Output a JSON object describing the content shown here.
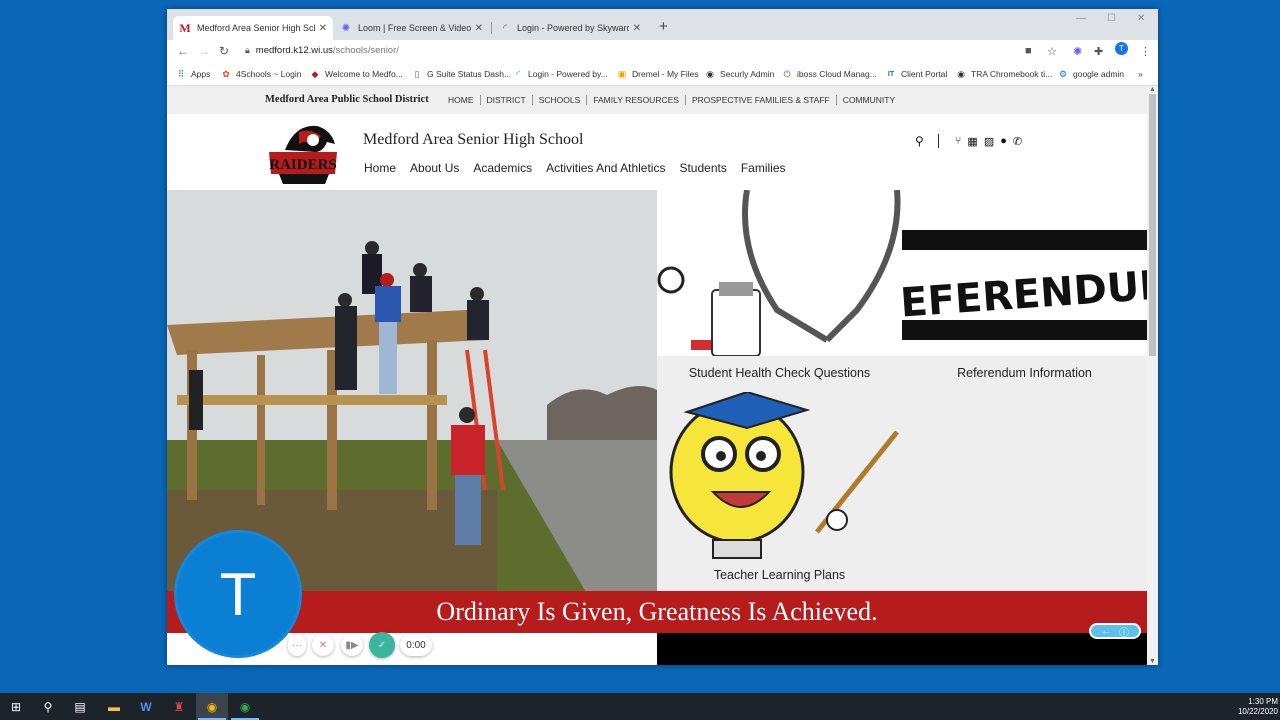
{
  "browser": {
    "tabs": [
      {
        "title": "Medford Area Senior High Schoo",
        "favicon": "M",
        "active": true
      },
      {
        "title": "Loom | Free Screen & Video Rec",
        "favicon": "loom-icon",
        "active": false
      },
      {
        "title": "Login - Powered by Skyward",
        "favicon": "skyward-icon",
        "active": false
      }
    ],
    "url_host": "medford.k12.wi.us",
    "url_path": "/schools/senior/",
    "profile_initial": "T",
    "bookmarks": [
      {
        "label": "Apps"
      },
      {
        "label": "4Schools ~ Login"
      },
      {
        "label": "Welcome to Medfo..."
      },
      {
        "label": "G Suite Status Dash..."
      },
      {
        "label": "Login - Powered by..."
      },
      {
        "label": "Dremel - My Files"
      },
      {
        "label": "Securly Admin"
      },
      {
        "label": "iboss Cloud Manag..."
      },
      {
        "label": "Client Portal"
      },
      {
        "label": "TRA Chromebook ti..."
      },
      {
        "label": "google admin"
      }
    ]
  },
  "site": {
    "district": "Medford Area Public School District",
    "utility_links": [
      "HOME",
      "DISTRICT",
      "SCHOOLS",
      "FAMILY RESOURCES",
      "PROSPECTIVE FAMILIES & STAFF",
      "COMMUNITY"
    ],
    "logo_text": "RAIDERS",
    "school_name": "Medford Area Senior High School",
    "nav": [
      "Home",
      "About Us",
      "Academics",
      "Activities And Athletics",
      "Students",
      "Families"
    ],
    "tiles": [
      {
        "caption": "Student Health Check Questions"
      },
      {
        "caption": "Referendum Information"
      },
      {
        "caption": "Teacher Learning Plans"
      }
    ],
    "referendum_text": "REFERENDUM",
    "banner": "Ordinary Is Given, Greatness Is Achieved."
  },
  "loom": {
    "avatar_initial": "T",
    "timer": "0:00"
  },
  "taskbar": {
    "time": "1:30 PM",
    "date": "10/22/2020"
  },
  "colors": {
    "desktop": "#0a67b7",
    "banner": "#b71c1c",
    "loom_blue": "#0a7fd4"
  }
}
